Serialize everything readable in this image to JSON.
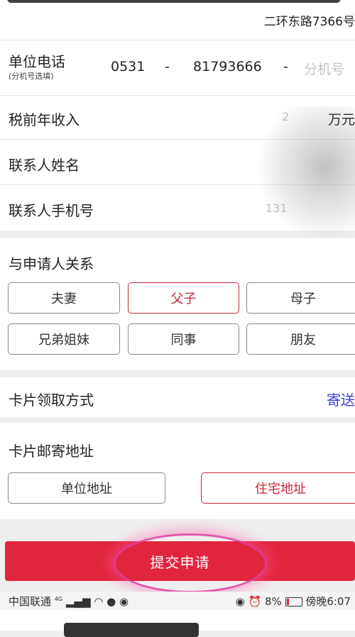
{
  "header": {
    "address": "二环东路7366号"
  },
  "fields": {
    "work_phone": {
      "label": "单位电话",
      "sub": "(分机号选填)",
      "area": "0531",
      "dash1": "-",
      "number": "81793666",
      "dash2": "-",
      "ext_placeholder": "分机号"
    },
    "income": {
      "label": "税前年收入",
      "value": "2",
      "unit": "万元"
    },
    "contact_name": {
      "label": "联系人姓名"
    },
    "contact_phone": {
      "label": "联系人手机号",
      "value": "131"
    }
  },
  "relation": {
    "title": "与申请人关系",
    "options": [
      "夫妻",
      "父子",
      "母子",
      "兄弟姐妹",
      "同事",
      "朋友"
    ],
    "selected": "父子"
  },
  "card_pickup": {
    "label": "卡片领取方式",
    "value": "寄送"
  },
  "mail_address": {
    "title": "卡片邮寄地址",
    "options": [
      "单位地址",
      "住宅地址"
    ],
    "selected": "住宅地址"
  },
  "submit": {
    "label": "提交申请"
  },
  "status_bar": {
    "carrier": "中国联通",
    "signal": "4G",
    "battery": "8%",
    "time": "傍晚6:07"
  },
  "colors": {
    "accent": "#e0253d",
    "selected_border": "#c8283a",
    "link_blue": "#3a3fd6"
  }
}
